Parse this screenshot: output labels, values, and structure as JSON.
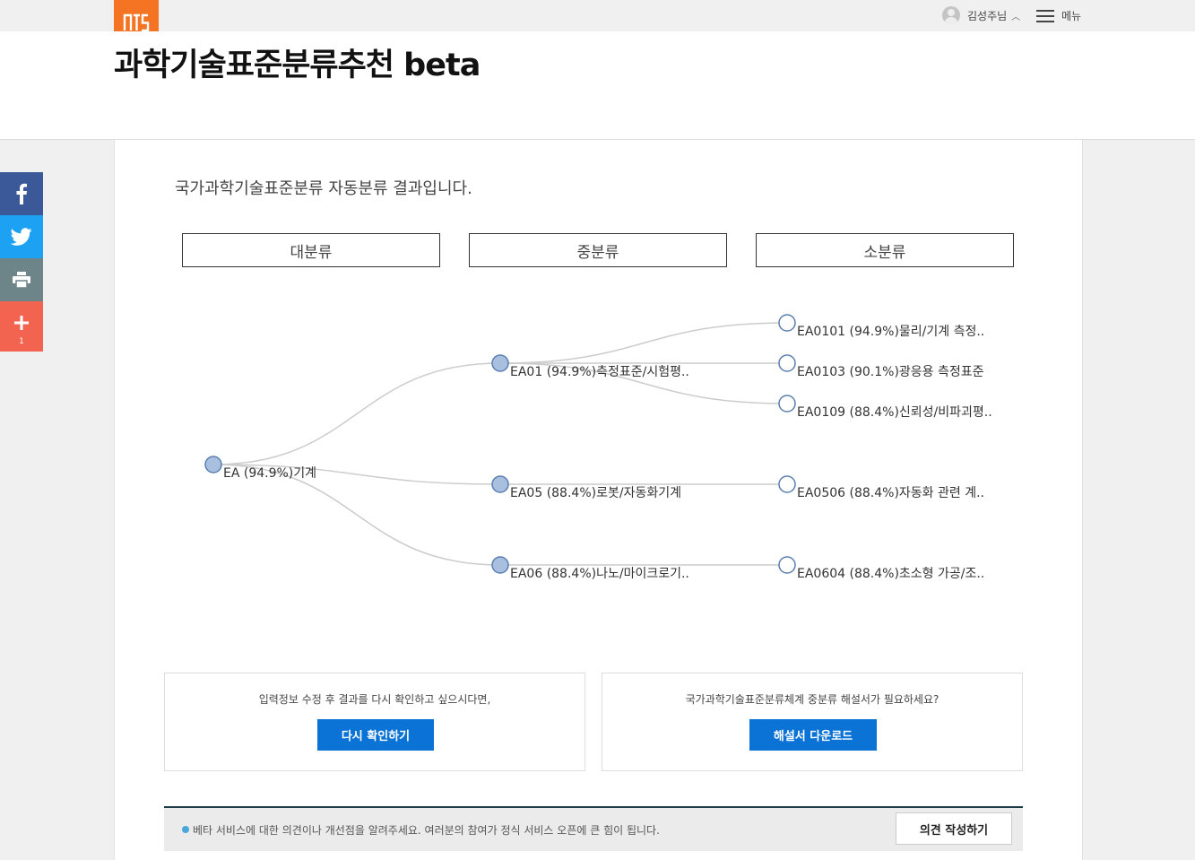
{
  "header": {
    "user_name": "김성주님",
    "menu_label": "메뉴",
    "title": "과학기술표준분류추천 beta"
  },
  "main": {
    "intro": "국가과학기술표준분류 자동분류 결과입니다.",
    "columns": [
      "대분류",
      "중분류",
      "소분류"
    ],
    "tree": {
      "large": [
        "EA (94.9%)기계"
      ],
      "medium": [
        "EA01 (94.9%)측정표준/시험평..",
        "EA05 (88.4%)로봇/자동화기계",
        "EA06 (88.4%)나노/마이크로기.."
      ],
      "small": [
        "EA0101 (94.9%)물리/기계 측정..",
        "EA0103 (90.1%)광응용 측정표준",
        "EA0109 (88.4%)신뢰성/비파괴평..",
        "EA0506 (88.4%)자동화 관련 계..",
        "EA0604 (88.4%)초소형 가공/조.."
      ]
    },
    "retry_box": {
      "text": "입력정보 수정 후 결과를 다시 확인하고 싶으시다면,",
      "button": "다시 확인하기"
    },
    "download_box": {
      "text": "국가과학기술표준분류체계 중분류 해설서가 필요하세요?",
      "button": "해설서 다운로드"
    },
    "feedback": {
      "text": "베타 서비스에 대한 의견이나 개선점을 알려주세요. 여러분의 참여가 정식 서비스 오픈에 큰 힘이 됩니다.",
      "button": "의견 작성하기"
    }
  },
  "social": {
    "share_count": "1"
  },
  "colors": {
    "brand": "#f47424",
    "primary_button": "#0b73d6",
    "facebook": "#3b5998",
    "twitter": "#1da1f2",
    "print": "#6d8489",
    "share": "#f26450",
    "node_fill": "#a8bfdf",
    "node_stroke": "#5a7fb0"
  }
}
